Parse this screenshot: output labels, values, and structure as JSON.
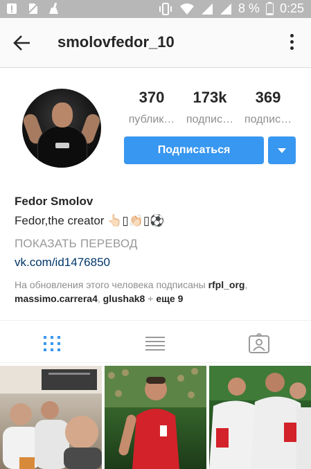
{
  "status_bar": {
    "battery_percent": "8 %",
    "time": "0:25",
    "icons": [
      "warning-icon",
      "no-sim-icon",
      "cleaner-icon",
      "vibrate-icon",
      "wifi-icon",
      "signal-icon",
      "signal-icon",
      "battery-icon"
    ]
  },
  "header": {
    "username": "smolovfedor_10",
    "back_icon": "arrow-left-icon",
    "menu_icon": "more-vertical-icon"
  },
  "profile": {
    "stats": [
      {
        "count": "370",
        "label": "публик…"
      },
      {
        "count": "173k",
        "label": "подпис…"
      },
      {
        "count": "369",
        "label": "подпис…"
      }
    ],
    "follow_button": "Подписаться",
    "full_name": "Fedor Smolov",
    "bio": "Fedor,the creator 👆🏻▯👏🏻▯⚽",
    "translate": "ПОКАЗАТЬ ПЕРЕВОД",
    "website": "vk.com/id1476850",
    "followed_by_prefix": "На обновления этого человека подписаны ",
    "followed_by_users": [
      "rfpl_org",
      "massimo.carrera4",
      "glushak8"
    ],
    "followed_by_suffix": "еще 9"
  },
  "tabs": [
    {
      "name": "grid-view",
      "icon": "grid-icon",
      "active": true
    },
    {
      "name": "list-view",
      "icon": "list-icon",
      "active": false
    },
    {
      "name": "tagged",
      "icon": "tagged-person-icon",
      "active": false
    }
  ],
  "colors": {
    "accent": "#3897f0",
    "link": "#003569",
    "status_bar": "#b7b7b7"
  }
}
